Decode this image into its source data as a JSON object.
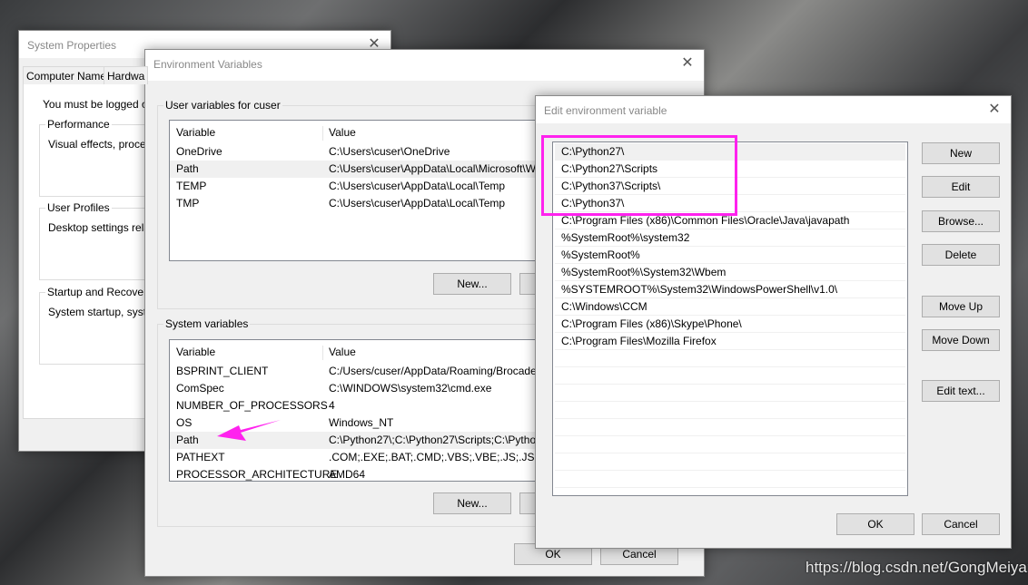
{
  "system_properties": {
    "title": "System Properties",
    "tabs": [
      "Computer Name",
      "Hardwa"
    ],
    "logon_text": "You must be logged on a",
    "groups": [
      {
        "label": "Performance",
        "text": "Visual effects, processo"
      },
      {
        "label": "User Profiles",
        "text": "Desktop settings relate"
      },
      {
        "label": "Startup and Recovery",
        "text": "System startup, system"
      }
    ]
  },
  "env_vars": {
    "title": "Environment Variables",
    "user_group": "User variables for cuser",
    "headers": [
      "Variable",
      "Value"
    ],
    "user_rows": [
      [
        "OneDrive",
        "C:\\Users\\cuser\\OneDrive"
      ],
      [
        "Path",
        "C:\\Users\\cuser\\AppData\\Local\\Microsoft\\W"
      ],
      [
        "TEMP",
        "C:\\Users\\cuser\\AppData\\Local\\Temp"
      ],
      [
        "TMP",
        "C:\\Users\\cuser\\AppData\\Local\\Temp"
      ]
    ],
    "user_new": "New...",
    "system_group": "System variables",
    "system_rows": [
      [
        "BSPRINT_CLIENT",
        "C:/Users/cuser/AppData/Roaming/Brocade"
      ],
      [
        "ComSpec",
        "C:\\WINDOWS\\system32\\cmd.exe"
      ],
      [
        "NUMBER_OF_PROCESSORS",
        "4"
      ],
      [
        "OS",
        "Windows_NT"
      ],
      [
        "Path",
        "C:\\Python27\\;C:\\Python27\\Scripts;C:\\Pytho"
      ],
      [
        "PATHEXT",
        ".COM;.EXE;.BAT;.CMD;.VBS;.VBE;.JS;.JSE;.WS"
      ],
      [
        "PROCESSOR_ARCHITECTURE",
        "AMD64"
      ]
    ],
    "system_new": "New...",
    "ok": "OK",
    "cancel": "Cancel"
  },
  "edit_env": {
    "title": "Edit environment variable",
    "entries": [
      "C:\\Python27\\",
      "C:\\Python27\\Scripts",
      "C:\\Python37\\Scripts\\",
      "C:\\Python37\\",
      "C:\\Program Files (x86)\\Common Files\\Oracle\\Java\\javapath",
      "%SystemRoot%\\system32",
      "%SystemRoot%",
      "%SystemRoot%\\System32\\Wbem",
      "%SYSTEMROOT%\\System32\\WindowsPowerShell\\v1.0\\",
      "C:\\Windows\\CCM",
      "C:\\Program Files (x86)\\Skype\\Phone\\",
      "C:\\Program Files\\Mozilla Firefox"
    ],
    "buttons": {
      "new": "New",
      "edit": "Edit",
      "browse": "Browse...",
      "delete": "Delete",
      "move_up": "Move Up",
      "move_down": "Move Down",
      "edit_text": "Edit text...",
      "ok": "OK",
      "cancel": "Cancel"
    }
  },
  "annotation_color": "#ff22ee",
  "watermark": "https://blog.csdn.net/GongMeiyan"
}
